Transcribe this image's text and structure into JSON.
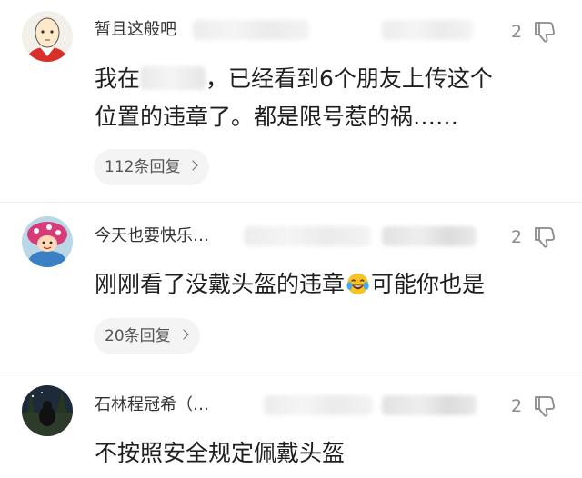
{
  "comments": [
    {
      "username": "暂且这般吧",
      "likes": "2",
      "text_line1_before": "我在",
      "text_line1_after": "，已经看到6个朋友上传这个",
      "text_line2": "位置的违章了。都是限号惹的祸……",
      "replies_label": "112条回复",
      "avatar_icon": "bald-hero-avatar",
      "dislike_icon": "thumbs-down-icon"
    },
    {
      "username": "今天也要快乐…",
      "likes": "2",
      "text_before": "刚刚看了没戴头盔的违章",
      "text_after": "可能你也是",
      "emoji": "laughing-tears-emoji",
      "replies_label": "20条回复",
      "avatar_icon": "cartoon-character-avatar",
      "dislike_icon": "thumbs-down-icon"
    },
    {
      "username": "石林程冠希（…",
      "likes": "2",
      "text": "不按照安全规定佩戴头盔",
      "avatar_icon": "night-landscape-avatar",
      "dislike_icon": "thumbs-down-icon"
    }
  ],
  "colors": {
    "text": "#1e1e1e",
    "meta": "#8a8a8a",
    "reply_pill": "#f4f4f4",
    "emoji_yellow": "#f7c325"
  }
}
